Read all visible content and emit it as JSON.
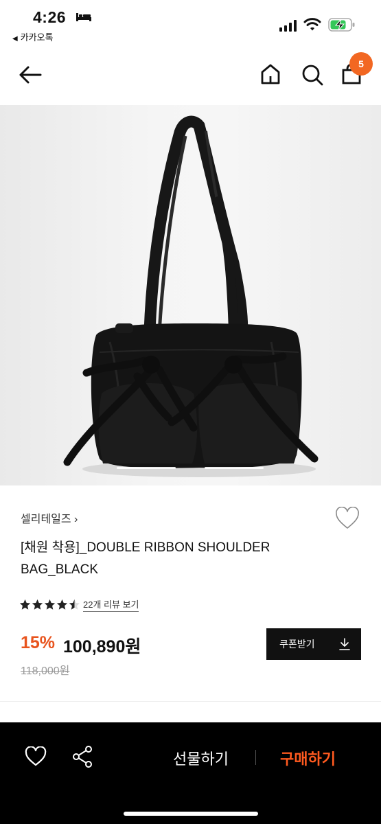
{
  "status_bar": {
    "time": "4:26",
    "back_app": "카카오톡",
    "icons": [
      "bed-icon",
      "signal-icon",
      "wifi-icon",
      "battery-charging-icon"
    ]
  },
  "nav": {
    "icons": [
      "back-arrow-icon",
      "home-icon",
      "search-icon",
      "shopping-bag-icon"
    ],
    "cart_count": "5"
  },
  "product": {
    "brand": "셀리테일즈 ›",
    "title": "[채원 착용]_DOUBLE RIBBON SHOULDER BAG_BLACK",
    "rating": 4.5,
    "review_link": "22개 리뷰 보기",
    "discount": "15%",
    "price": "100,890원",
    "original_price": "118,000원",
    "coupon_label": "쿠폰받기"
  },
  "bottom_bar": {
    "gift_label": "선물하기",
    "buy_label": "구매하기"
  },
  "colors": {
    "accent": "#e8541e",
    "badge": "#f26722",
    "bar_bg": "#000000"
  }
}
